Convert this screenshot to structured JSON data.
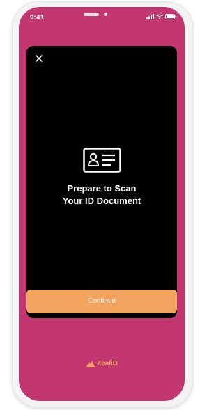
{
  "status_bar": {
    "time": "9:41"
  },
  "modal": {
    "prompt_line1": "Prepare to Scan",
    "prompt_line2": "Your ID Document",
    "continue_label": "Continue"
  },
  "brand": {
    "name": "ZealiD"
  },
  "colors": {
    "background": "#c2376f",
    "modal": "#000000",
    "accent": "#f2a35e",
    "text": "#ffffff"
  },
  "icons": [
    "close-icon",
    "id-card-icon",
    "signal-icon",
    "wifi-icon",
    "battery-icon",
    "zealid-logo-icon"
  ]
}
